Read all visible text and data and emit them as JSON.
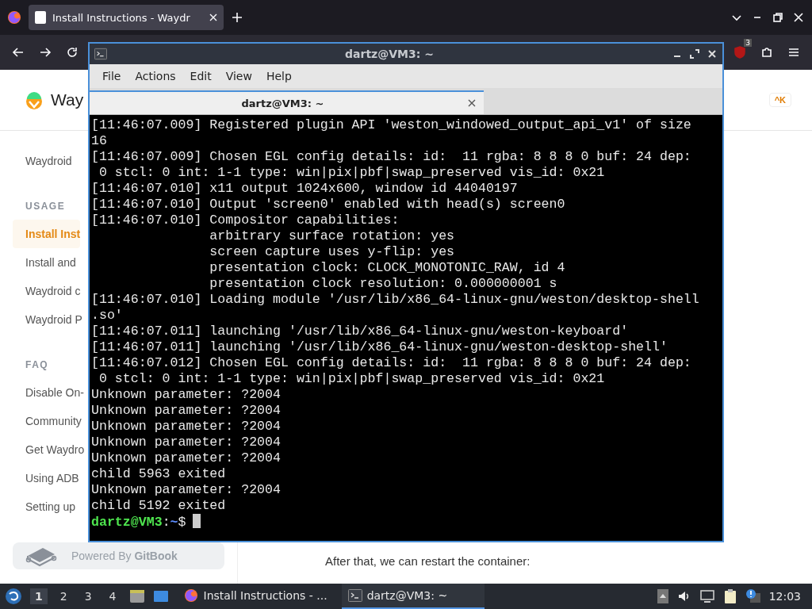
{
  "browser": {
    "tabs": [
      {
        "title": "Install Instructions - Waydr",
        "selected": true
      }
    ],
    "toolbar": {
      "extension_badge": "3"
    },
    "page": {
      "logo_text": "Way",
      "search_shortcut": "^K",
      "sidebar": {
        "groups": [
          {
            "items": [
              {
                "label": "Waydroid",
                "selected": false
              }
            ]
          },
          {
            "heading": "USAGE",
            "items": [
              {
                "label": "Install Inst",
                "selected": true
              },
              {
                "label": "Install and",
                "selected": false
              },
              {
                "label": "Waydroid c",
                "selected": false
              },
              {
                "label": "Waydroid P",
                "selected": false
              }
            ]
          },
          {
            "heading": "FAQ",
            "items": [
              {
                "label": "Disable On-",
                "selected": false
              },
              {
                "label": "Community",
                "selected": false
              },
              {
                "label": "Get Waydro",
                "selected": false
              },
              {
                "label": "Using ADB",
                "selected": false
              },
              {
                "label": "Setting up",
                "selected": false
              }
            ]
          }
        ]
      },
      "powered_by": "Powered By **GitBook**",
      "body_text": "After that, we can restart the container:"
    }
  },
  "terminal": {
    "title": "dartz@VM3: ~",
    "menu": [
      "File",
      "Actions",
      "Edit",
      "View",
      "Help"
    ],
    "tabs": [
      {
        "title": "dartz@VM3: ~",
        "selected": true
      }
    ],
    "lines": [
      {
        "kind": "output",
        "text": "[11:46:07.009] Registered plugin API 'weston_windowed_output_api_v1' of size"
      },
      {
        "kind": "output",
        "text": "16"
      },
      {
        "kind": "output",
        "text": "[11:46:07.009] Chosen EGL config details: id:  11 rgba: 8 8 8 0 buf: 24 dep:"
      },
      {
        "kind": "output",
        "text": " 0 stcl: 0 int: 1-1 type: win|pix|pbf|swap_preserved vis_id: 0x21"
      },
      {
        "kind": "output",
        "text": "[11:46:07.010] x11 output 1024x600, window id 44040197"
      },
      {
        "kind": "output",
        "text": "[11:46:07.010] Output 'screen0' enabled with head(s) screen0"
      },
      {
        "kind": "output",
        "text": "[11:46:07.010] Compositor capabilities:"
      },
      {
        "kind": "output",
        "text": "               arbitrary surface rotation: yes"
      },
      {
        "kind": "output",
        "text": "               screen capture uses y-flip: yes"
      },
      {
        "kind": "output",
        "text": "               presentation clock: CLOCK_MONOTONIC_RAW, id 4"
      },
      {
        "kind": "output",
        "text": "               presentation clock resolution: 0.000000001 s"
      },
      {
        "kind": "output",
        "text": "[11:46:07.010] Loading module '/usr/lib/x86_64-linux-gnu/weston/desktop-shell"
      },
      {
        "kind": "output",
        "text": ".so'"
      },
      {
        "kind": "output",
        "text": "[11:46:07.011] launching '/usr/lib/x86_64-linux-gnu/weston-keyboard'"
      },
      {
        "kind": "output",
        "text": "[11:46:07.011] launching '/usr/lib/x86_64-linux-gnu/weston-desktop-shell'"
      },
      {
        "kind": "output",
        "text": "[11:46:07.012] Chosen EGL config details: id:  11 rgba: 8 8 8 0 buf: 24 dep:"
      },
      {
        "kind": "output",
        "text": " 0 stcl: 0 int: 1-1 type: win|pix|pbf|swap_preserved vis_id: 0x21"
      },
      {
        "kind": "output",
        "text": "Unknown parameter: ?2004"
      },
      {
        "kind": "output",
        "text": "Unknown parameter: ?2004"
      },
      {
        "kind": "output",
        "text": "Unknown parameter: ?2004"
      },
      {
        "kind": "output",
        "text": "Unknown parameter: ?2004"
      },
      {
        "kind": "output",
        "text": "Unknown parameter: ?2004"
      },
      {
        "kind": "output",
        "text": "child 5963 exited"
      },
      {
        "kind": "output",
        "text": "Unknown parameter: ?2004"
      },
      {
        "kind": "output",
        "text": "child 5192 exited"
      },
      {
        "kind": "prompt",
        "user": "dartz@VM3",
        "separator": ":",
        "path": "~",
        "symbol": "$"
      }
    ]
  },
  "taskbar": {
    "workspaces": [
      {
        "label": "1",
        "selected": true
      },
      {
        "label": "2",
        "selected": false
      },
      {
        "label": "3",
        "selected": false
      },
      {
        "label": "4",
        "selected": false
      }
    ],
    "tasks": [
      {
        "kind": "browser",
        "title": "Install Instructions - ...",
        "selected": false
      },
      {
        "kind": "terminal",
        "title": "dartz@VM3: ~",
        "selected": true
      }
    ],
    "clock": "12:03"
  }
}
